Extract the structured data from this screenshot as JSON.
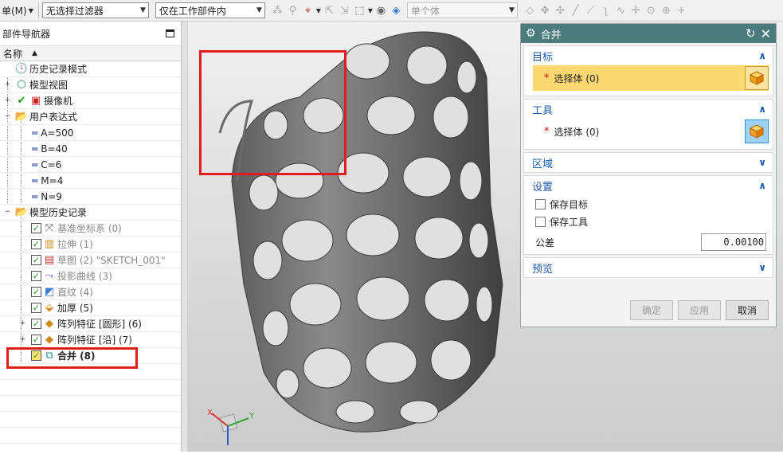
{
  "toolbar": {
    "menu_label": "单(M)",
    "filter_select": "无选择过滤器",
    "scope_select": "仅在工作部件内",
    "body_select": "单个体"
  },
  "navigator": {
    "title": "部件导航器",
    "column_name": "名称",
    "items": [
      {
        "label": "历史记录模式"
      },
      {
        "label": "模型视图"
      },
      {
        "label": "摄像机"
      },
      {
        "label": "用户表达式"
      },
      {
        "label": "A=500"
      },
      {
        "label": "B=40"
      },
      {
        "label": "C=6"
      },
      {
        "label": "M=4"
      },
      {
        "label": "N=9"
      },
      {
        "label": "模型历史记录"
      },
      {
        "label": "基准坐标系 (0)"
      },
      {
        "label": "拉伸 (1)"
      },
      {
        "label": "草图 (2) \"SKETCH_001\""
      },
      {
        "label": "投影曲线 (3)"
      },
      {
        "label": "直纹 (4)"
      },
      {
        "label": "加厚 (5)"
      },
      {
        "label": "阵列特征 [圆形] (6)"
      },
      {
        "label": "阵列特征 [沿] (7)"
      },
      {
        "label": "合并 (8)"
      }
    ]
  },
  "dialog": {
    "title": "合并",
    "target": {
      "header": "目标",
      "select_label": "选择体 (0)"
    },
    "tool": {
      "header": "工具",
      "select_label": "选择体 (0)"
    },
    "region": {
      "header": "区域"
    },
    "settings": {
      "header": "设置",
      "keep_target": "保存目标",
      "keep_tool": "保存工具",
      "tolerance_label": "公差",
      "tolerance_value": "0.00100"
    },
    "preview": {
      "header": "预览"
    },
    "buttons": {
      "ok": "确定",
      "apply": "应用",
      "cancel": "取消"
    }
  },
  "colors": {
    "dialog_title_bg": "#4b7b7d",
    "section_header": "#1e5aa8",
    "active_selection": "#fcd873",
    "highlight_box": "#e01c1c"
  }
}
